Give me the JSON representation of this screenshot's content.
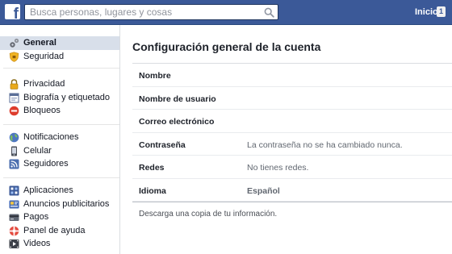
{
  "header": {
    "logo_letter": "f",
    "search_placeholder": "Busca personas, lugares y cosas",
    "home_label": "Inicio",
    "home_badge": "1",
    "brand_color": "#3b5998"
  },
  "sidebar": {
    "groups": [
      [
        {
          "label": "General",
          "icon": "gear-icon",
          "selected": true
        },
        {
          "label": "Seguridad",
          "icon": "shield-icon"
        }
      ],
      [
        {
          "label": "Privacidad",
          "icon": "lock-icon"
        },
        {
          "label": "Biografía y etiquetado",
          "icon": "timeline-icon"
        },
        {
          "label": "Bloqueos",
          "icon": "block-icon"
        }
      ],
      [
        {
          "label": "Notificaciones",
          "icon": "globe-icon"
        },
        {
          "label": "Celular",
          "icon": "phone-icon"
        },
        {
          "label": "Seguidores",
          "icon": "rss-icon"
        }
      ],
      [
        {
          "label": "Aplicaciones",
          "icon": "apps-icon"
        },
        {
          "label": "Anuncios publicitarios",
          "icon": "ads-icon"
        },
        {
          "label": "Pagos",
          "icon": "payments-icon"
        },
        {
          "label": "Panel de ayuda",
          "icon": "help-icon"
        },
        {
          "label": "Videos",
          "icon": "video-icon"
        }
      ]
    ]
  },
  "main": {
    "title": "Configuración general de la cuenta",
    "rows": [
      {
        "label": "Nombre",
        "value": ""
      },
      {
        "label": "Nombre de usuario",
        "value": ""
      },
      {
        "label": "Correo electrónico",
        "value": ""
      },
      {
        "label": "Contraseña",
        "value": "La contraseña no se ha cambiado nunca."
      },
      {
        "label": "Redes",
        "value": "No tienes redes."
      },
      {
        "label": "Idioma",
        "value": "Español"
      }
    ],
    "download_link": "Descarga una copia de tu información."
  }
}
